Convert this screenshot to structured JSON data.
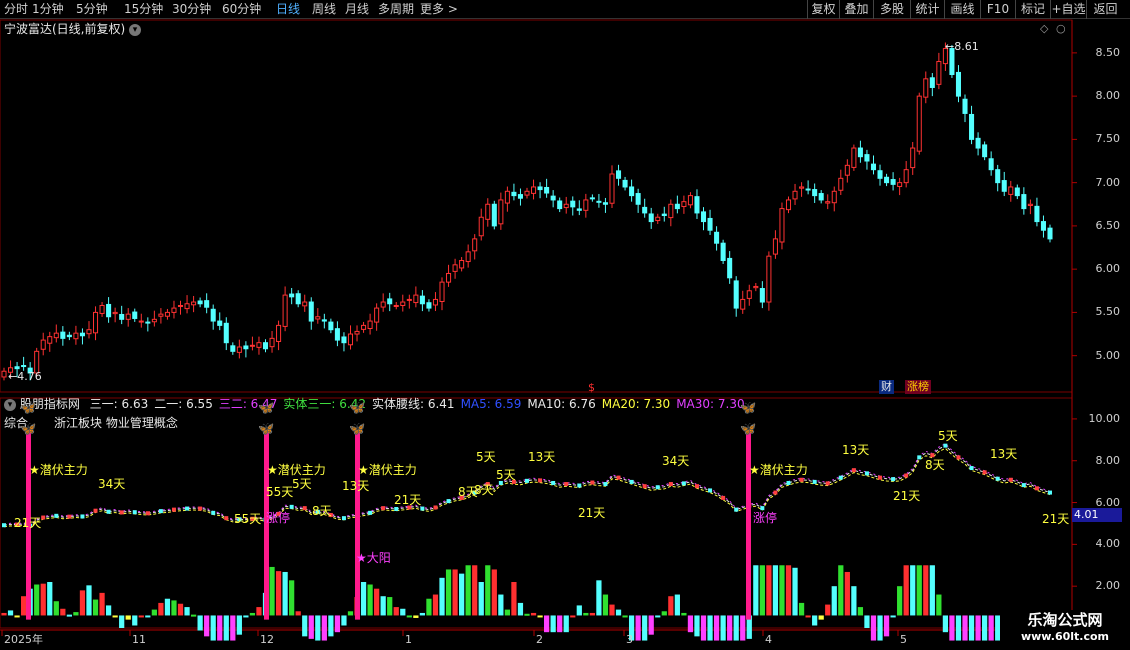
{
  "toolbar": {
    "periods": [
      "分时",
      "1分钟",
      "5分钟",
      "15分钟",
      "30分钟",
      "60分钟",
      "日线",
      "周线",
      "月线",
      "多周期",
      "更多"
    ],
    "active": "日线",
    "right": [
      "复权",
      "叠加",
      "多股",
      "统计",
      "画线",
      "F10",
      "标记",
      "+自选",
      "返回"
    ]
  },
  "main_chart": {
    "title": "宁波富达(日线,前复权)",
    "y_ticks": [
      "8.50",
      "8.00",
      "7.50",
      "7.00",
      "6.50",
      "6.00",
      "5.50",
      "5.00"
    ],
    "ylim": [
      4.58,
      8.88
    ],
    "high_label": "8.61",
    "low_label": "4.76",
    "markers": {
      "dollar": "$",
      "cai": "财",
      "zhangbang": "涨榜"
    }
  },
  "indicator": {
    "name": "股朋指标网",
    "values": [
      {
        "label": "三一: 6.63",
        "color": "#e8e8e8"
      },
      {
        "label": "二一: 6.55",
        "color": "#e8e8e8"
      },
      {
        "label": "三二: 6.47",
        "color": "#e040ff"
      },
      {
        "label": "实体三一: 6.42",
        "color": "#40e040"
      },
      {
        "label": "实体腰线: 6.41",
        "color": "#e8e8e8"
      },
      {
        "label": "MA5: 6.59",
        "color": "#3050ff"
      },
      {
        "label": "MA10: 6.76",
        "color": "#e8e8e8"
      },
      {
        "label": "MA20: 7.30",
        "color": "#ffff40"
      },
      {
        "label": "MA30: 7.30",
        "color": "#e040ff"
      }
    ],
    "sector_text": "综合",
    "concepts": "浙江板块  物业管理概念",
    "y_ticks": [
      "10.00",
      "8.00",
      "6.00",
      "4.00",
      "2.00"
    ],
    "current_value": "4.01",
    "signal_label": "潜伏主力",
    "day_labels": [
      "21天",
      "34天",
      "55天",
      "55天",
      "5天",
      "8天",
      "13天",
      "21天",
      "5天",
      "8天",
      "13天",
      "21天",
      "34天",
      "5天",
      "8天",
      "13天",
      "21天",
      "5天",
      "8天",
      "13天",
      "21天"
    ],
    "special_labels": {
      "dayang": "大阳",
      "zhangting": "涨停"
    }
  },
  "x_axis": {
    "labels": [
      "2025年",
      "11",
      "12",
      "1",
      "2",
      "3",
      "4",
      "5"
    ]
  },
  "watermark": {
    "title": "乐淘公式网",
    "url": "www.60lt.com"
  },
  "chart_data": {
    "type": "candlestick",
    "title": "宁波富达(日线,前复权)",
    "ylim": [
      4.58,
      8.88
    ],
    "y_ticks": [
      5.0,
      5.5,
      6.0,
      6.5,
      7.0,
      7.5,
      8.0,
      8.5
    ],
    "x_labels": [
      "2025年",
      "11",
      "12",
      "1",
      "2",
      "3",
      "4",
      "5"
    ],
    "closes": [
      4.82,
      4.86,
      4.85,
      4.88,
      4.8,
      5.05,
      5.18,
      5.22,
      5.26,
      5.2,
      5.22,
      5.26,
      5.23,
      5.3,
      5.5,
      5.58,
      5.45,
      5.5,
      5.42,
      5.48,
      5.43,
      5.4,
      5.38,
      5.42,
      5.48,
      5.5,
      5.55,
      5.58,
      5.6,
      5.62,
      5.6,
      5.56,
      5.4,
      5.35,
      5.15,
      5.05,
      5.1,
      5.08,
      5.12,
      5.15,
      5.08,
      5.2,
      5.35,
      5.7,
      5.68,
      5.6,
      5.62,
      5.4,
      5.45,
      5.4,
      5.3,
      5.18,
      5.15,
      5.25,
      5.28,
      5.35,
      5.4,
      5.55,
      5.62,
      5.6,
      5.58,
      5.62,
      5.65,
      5.7,
      5.6,
      5.55,
      5.65,
      5.85,
      5.95,
      6.05,
      6.1,
      6.2,
      6.35,
      6.6,
      6.75,
      6.5,
      6.8,
      6.9,
      6.85,
      6.82,
      6.9,
      6.95,
      6.92,
      6.88,
      6.8,
      6.7,
      6.75,
      6.72,
      6.68,
      6.8,
      6.82,
      6.78,
      6.75,
      7.1,
      7.05,
      6.95,
      6.85,
      6.75,
      6.65,
      6.55,
      6.6,
      6.62,
      6.75,
      6.7,
      6.78,
      6.85,
      6.65,
      6.55,
      6.45,
      6.3,
      6.1,
      5.9,
      5.55,
      5.65,
      5.75,
      5.8,
      5.62,
      6.15,
      6.35,
      6.7,
      6.8,
      6.9,
      6.95,
      6.92,
      6.85,
      6.8,
      6.78,
      6.9,
      7.05,
      7.2,
      7.4,
      7.3,
      7.25,
      7.15,
      7.05,
      7.0,
      6.98,
      7.0,
      7.15,
      7.4,
      8.0,
      8.2,
      8.1,
      8.4,
      8.55,
      8.25,
      8.0,
      7.8,
      7.5,
      7.4,
      7.3,
      7.15,
      7.0,
      6.9,
      6.95,
      6.85,
      6.7,
      6.75,
      6.55,
      6.45,
      6.35
    ]
  }
}
